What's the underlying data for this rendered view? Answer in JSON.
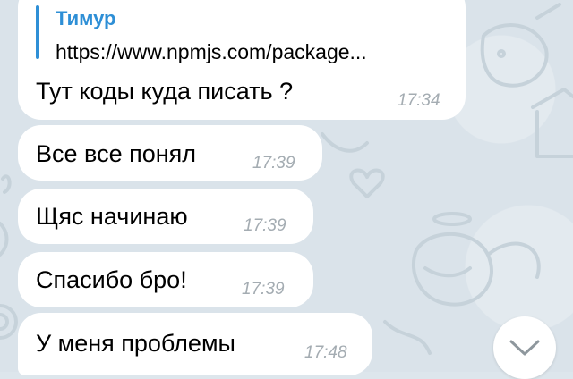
{
  "chat": {
    "messages": [
      {
        "reply_to": {
          "author": "Тимур",
          "text": "https://www.npmjs.com/package..."
        },
        "text": "Тут коды куда писать  ?",
        "time": "17:34"
      },
      {
        "text": "Все все понял",
        "time": "17:39"
      },
      {
        "text": "Щяс начинаю",
        "time": "17:39"
      },
      {
        "text": "Спасибо бро!",
        "time": "17:39"
      },
      {
        "text": "У меня проблемы",
        "time": "17:48"
      }
    ]
  },
  "scroll_button": {
    "icon": "chevron-down-icon"
  },
  "colors": {
    "background": "#dae3ea",
    "bubble": "#ffffff",
    "accent": "#2e8fd6",
    "timestamp": "#a4acb2"
  }
}
